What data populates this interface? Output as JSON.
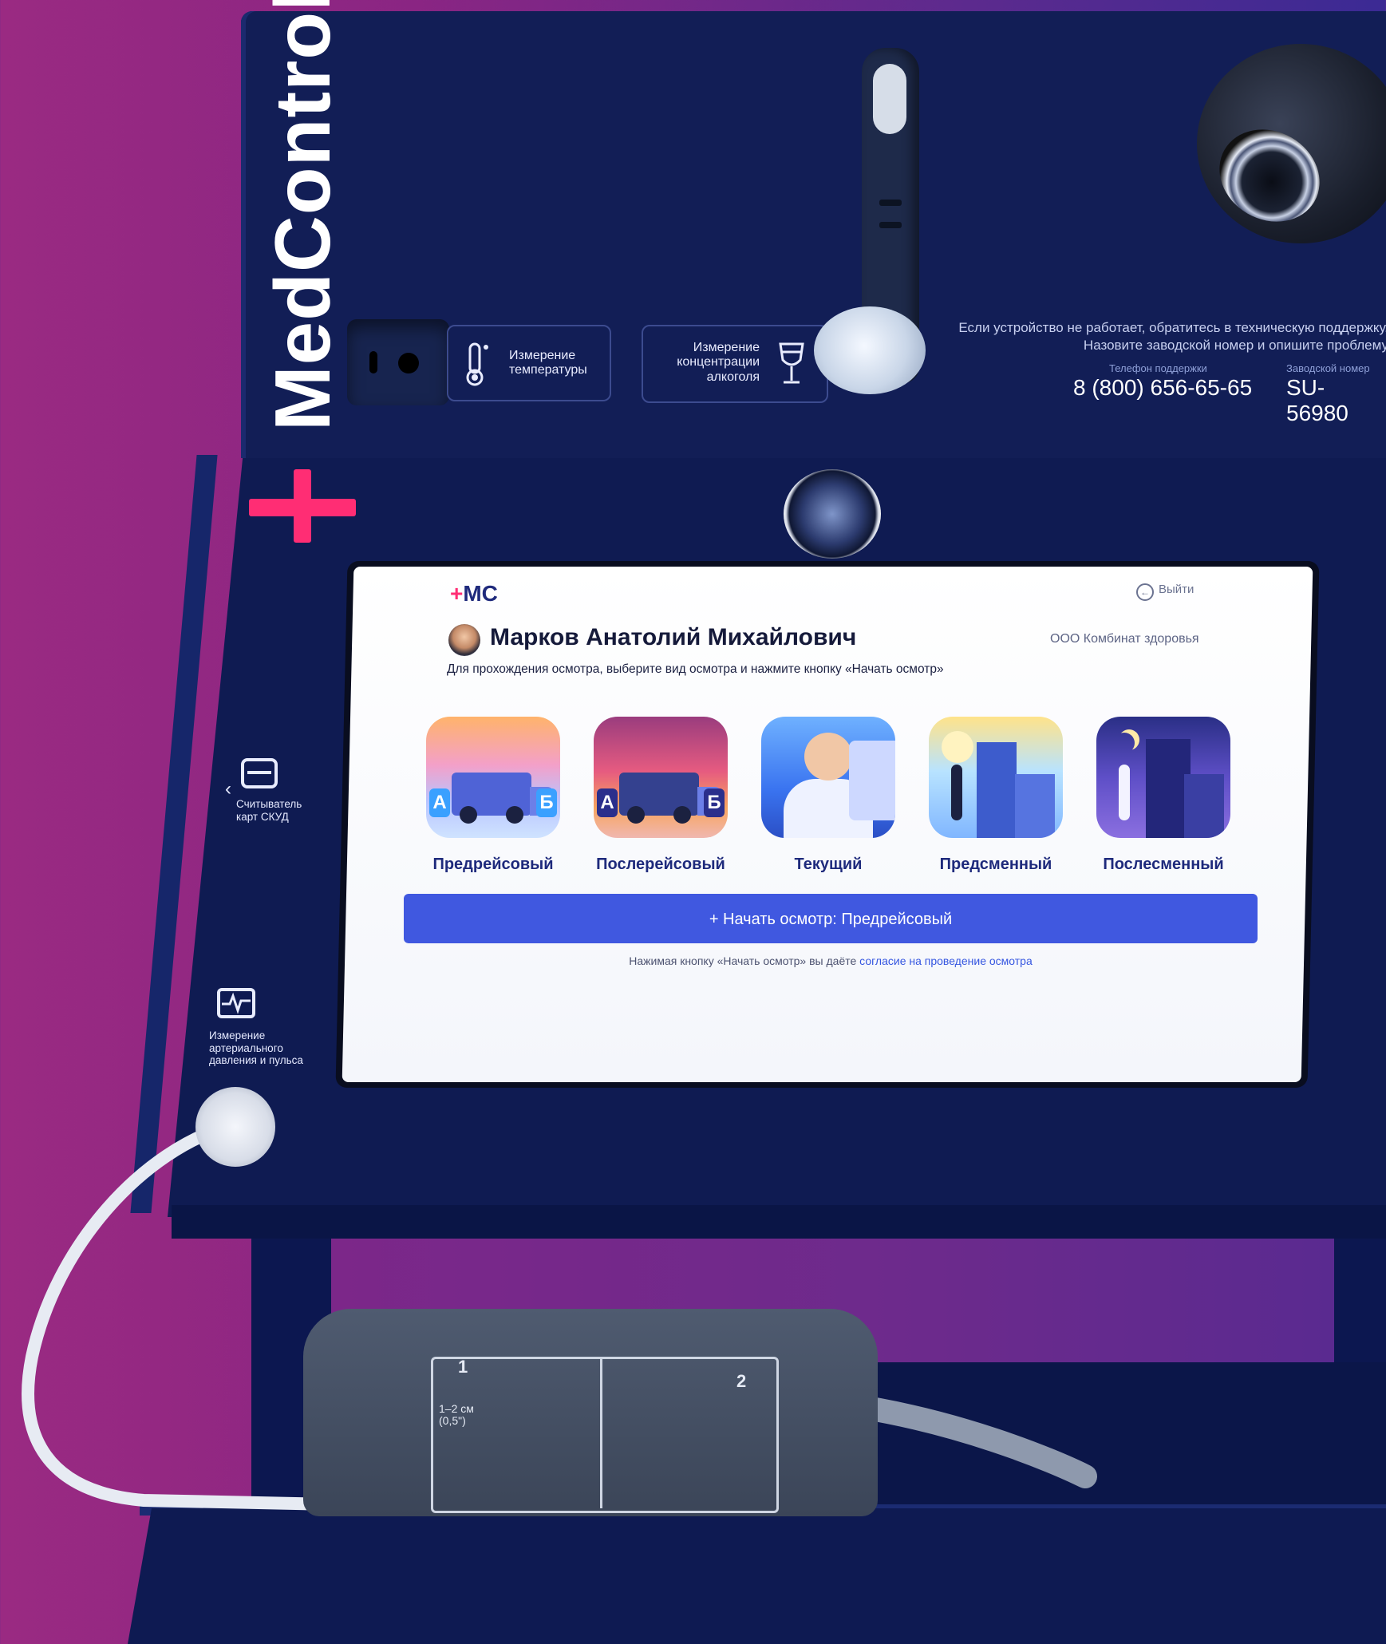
{
  "brand": {
    "name": "MedControl",
    "accent": "#ff2d74"
  },
  "hardware": {
    "temperature_label": "Измерение температуры",
    "alcohol_label": "Измерение концентрации алкоголя",
    "card_reader_label": "Считыватель карт СКУД",
    "bp_label": "Измерение артериального давления и пульса"
  },
  "support": {
    "message": "Если устройство не работает, обратитесь в техническую поддержку. Назовите заводской номер и опишите проблему",
    "phone_label": "Телефон поддержки",
    "phone": "8 (800) 656-65-65",
    "serial_label": "Заводской номер",
    "serial": "SU-56980"
  },
  "cuff": {
    "step1": "1",
    "step2": "2",
    "note": "1–2 см (0,5\")"
  },
  "screen": {
    "logo": "MC",
    "logo_plus": "+",
    "logout_label": "Выйти",
    "user_name": "Марков Анатолий Михайлович",
    "organization": "ООО Комбинат здоровья",
    "instruction": "Для прохождения осмотра, выберите вид осмотра и нажмите кнопку «Начать осмотр»",
    "exam_types": [
      {
        "label": "Предрейсовый"
      },
      {
        "label": "Послерейсовый"
      },
      {
        "label": "Текущий"
      },
      {
        "label": "Предсменный"
      },
      {
        "label": "Послесменный"
      }
    ],
    "start_button_label": "+ Начать осмотр: Предрейсовый",
    "consent_prefix": "Нажимая кнопку «Начать осмотр» вы даёте ",
    "consent_link": "согласие на проведение осмотра",
    "badge_a": "А",
    "badge_b": "Б",
    "primary_color": "#4058e0"
  }
}
